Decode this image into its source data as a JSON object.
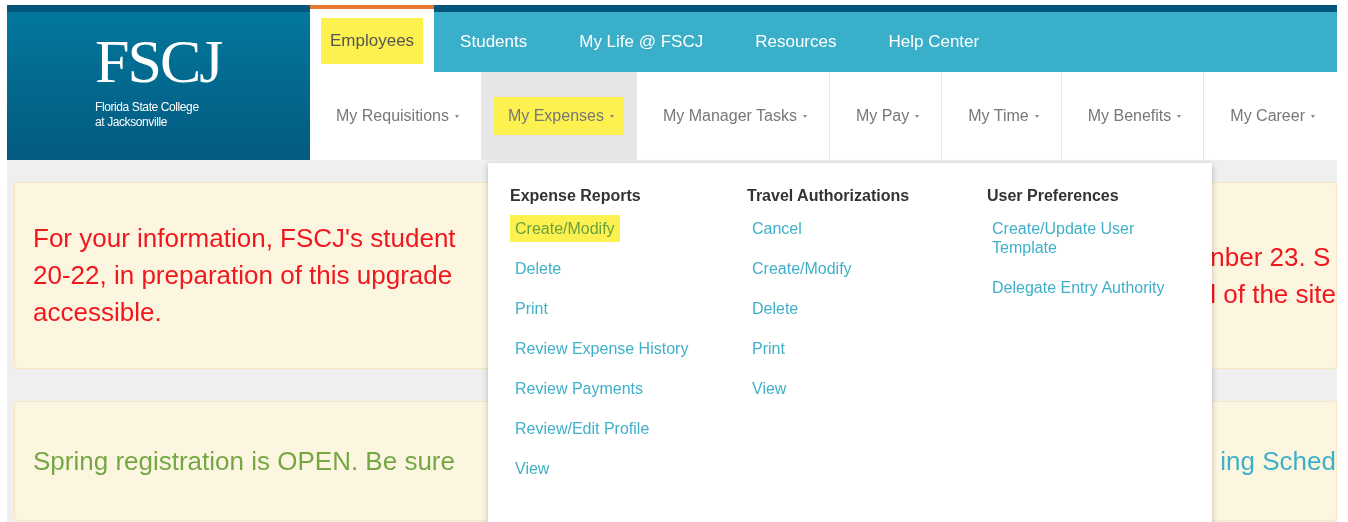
{
  "logo": {
    "title": "FSCJ",
    "subtitle_lines": [
      "Florida State College",
      "at Jacksonville"
    ]
  },
  "top_nav": [
    {
      "label": "Employees",
      "selected": true,
      "highlighted": true
    },
    {
      "label": "Students",
      "selected": false,
      "highlighted": false
    },
    {
      "label": "My Life @ FSCJ",
      "selected": false,
      "highlighted": false
    },
    {
      "label": "Resources",
      "selected": false,
      "highlighted": false
    },
    {
      "label": "Help Center",
      "selected": false,
      "highlighted": false
    }
  ],
  "sub_nav": [
    {
      "label": "My Requisitions",
      "selected": false,
      "highlighted": false
    },
    {
      "label": "My Expenses",
      "selected": true,
      "highlighted": true
    },
    {
      "label": "My Manager Tasks",
      "selected": false,
      "highlighted": false
    },
    {
      "label": "My Pay",
      "selected": false,
      "highlighted": false
    },
    {
      "label": "My Time",
      "selected": false,
      "highlighted": false
    },
    {
      "label": "My Benefits",
      "selected": false,
      "highlighted": false
    },
    {
      "label": "My Career",
      "selected": false,
      "highlighted": false
    }
  ],
  "dropdown": {
    "columns": [
      {
        "heading": "Expense Reports",
        "items": [
          {
            "label": "Create/Modify",
            "highlighted": true
          },
          {
            "label": "Delete",
            "highlighted": false
          },
          {
            "label": "Print",
            "highlighted": false
          },
          {
            "label": "Review Expense History",
            "highlighted": false
          },
          {
            "label": "Review Payments",
            "highlighted": false
          },
          {
            "label": "Review/Edit Profile",
            "highlighted": false
          },
          {
            "label": "View",
            "highlighted": false
          }
        ]
      },
      {
        "heading": "Travel Authorizations",
        "items": [
          {
            "label": "Cancel",
            "highlighted": false
          },
          {
            "label": "Create/Modify",
            "highlighted": false
          },
          {
            "label": "Delete",
            "highlighted": false
          },
          {
            "label": "Print",
            "highlighted": false
          },
          {
            "label": "View",
            "highlighted": false
          }
        ]
      },
      {
        "heading": "User Preferences",
        "items": [
          {
            "label": "Create/Update User Template",
            "highlighted": false
          },
          {
            "label": "Delegate Entry Authority",
            "highlighted": false
          }
        ]
      }
    ]
  },
  "notices": [
    {
      "kind": "alert",
      "left_lines": [
        "For your information, FSCJ's student",
        "20-22, in preparation of this upgrade",
        "accessible."
      ],
      "right_lines": [
        "nber 23. S",
        "l of the site"
      ]
    },
    {
      "kind": "info",
      "left_lines": [
        "Spring registration is OPEN. Be sure"
      ],
      "right_lines": [
        "ing Sched"
      ]
    }
  ]
}
